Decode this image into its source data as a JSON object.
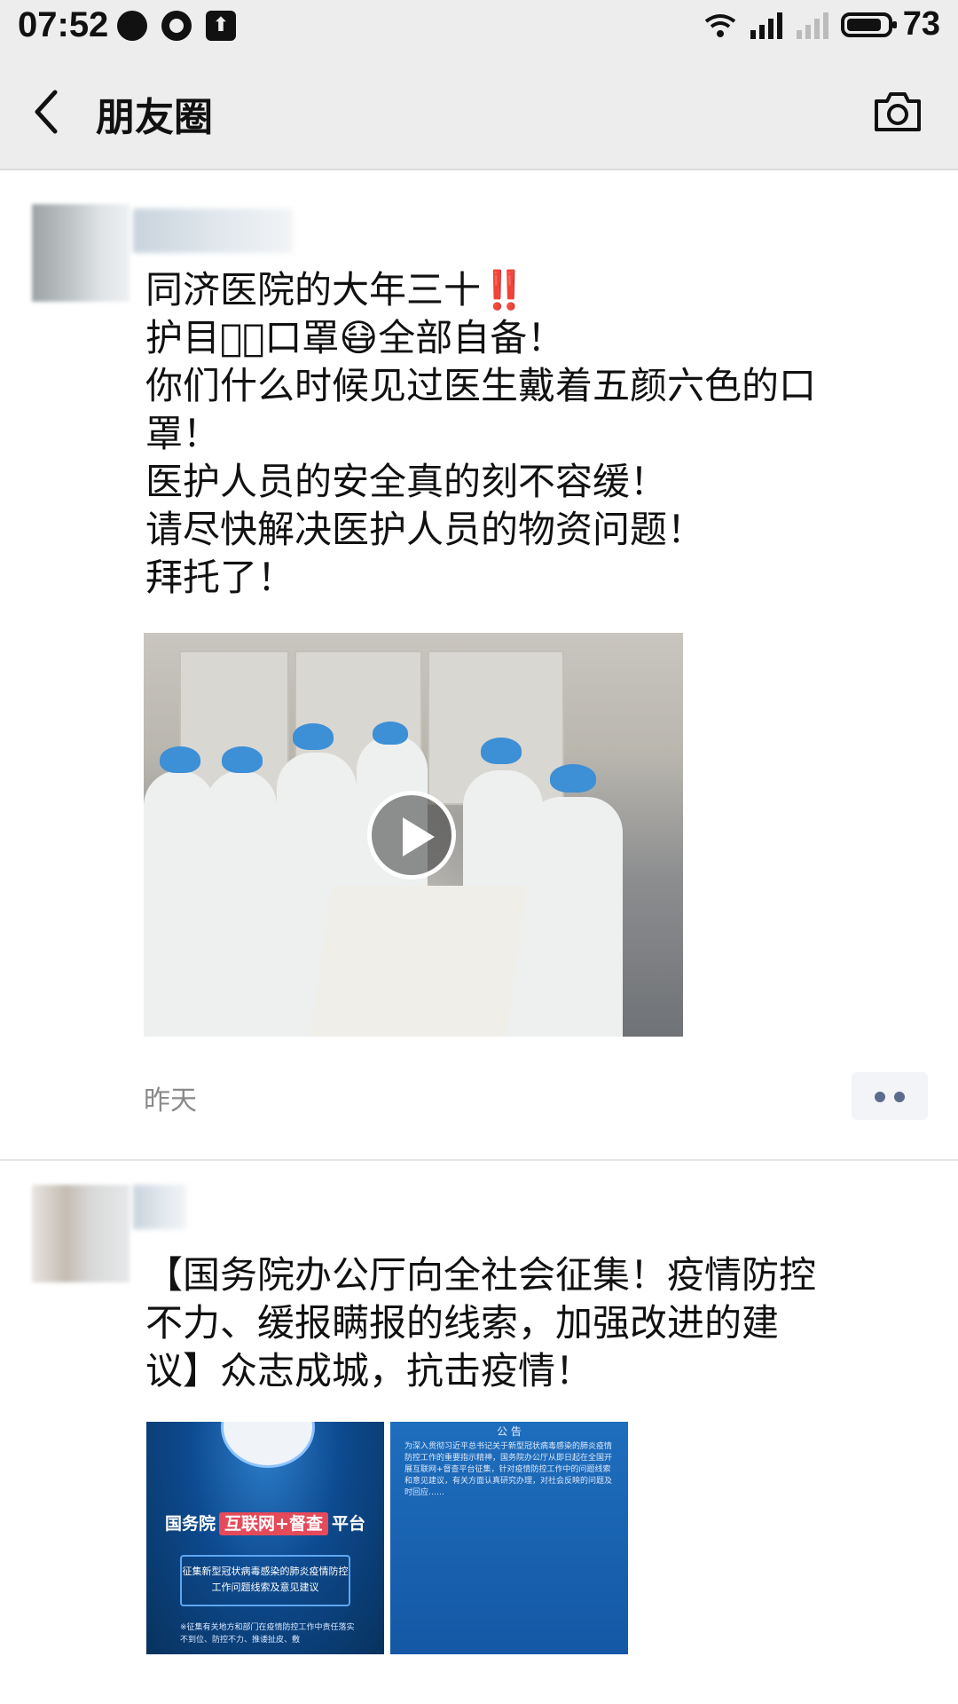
{
  "status_bar": {
    "time": "07:52",
    "battery": "73",
    "icons": [
      "notification-dot-icon",
      "water-drop-icon",
      "upload-icon",
      "wifi-icon",
      "signal-icon",
      "signal-2-icon",
      "battery-icon"
    ]
  },
  "nav": {
    "title": "朋友圈",
    "back_icon": "chevron-left-icon",
    "camera_icon": "camera-icon"
  },
  "posts": [
    {
      "lines": [
        "同济医院的大年三十‼️",
        "护目镜⃣口罩😷全部自备！",
        "你们什么时候见过医生戴着五颜六色的口",
        "罩！",
        "医护人员的安全真的刻不容缓！",
        "请尽快解决医护人员的物资问题！",
        "拜托了！"
      ],
      "timestamp": "昨天",
      "media": "video"
    },
    {
      "lines": [
        "【国务院办公厅向全社会征集！疫情防控",
        "不力、缓报瞒报的线索，加强改进的建",
        "议】众志成城，抗击疫情！"
      ],
      "image_left": {
        "title_pre": "国务院",
        "title_tag": "互联网+督查",
        "title_post": "平台",
        "box_text": "征集新型冠状病毒感染的肺炎疫情防控工作问题线索及意见建议",
        "foot_text": "※征集有关地方和部门在疫情防控工作中责任落实不到位、防控不力、推诿扯皮、敷"
      },
      "image_right": {
        "title": "公 告",
        "body": "为深入贯彻习近平总书记关于新型冠状病毒感染的肺炎疫情防控工作的重要指示精神，国务院办公厅从即日起在全国开展互联网+督查平台征集，针对疫情防控工作中的问题线索和意见建议，有关方面认真研究办理，对社会反映的问题及时回应……"
      }
    }
  ],
  "colors": {
    "nav_bg": "#ededed",
    "link_blue": "#5b6c8c",
    "timestamp_gray": "#8a8a8a"
  }
}
